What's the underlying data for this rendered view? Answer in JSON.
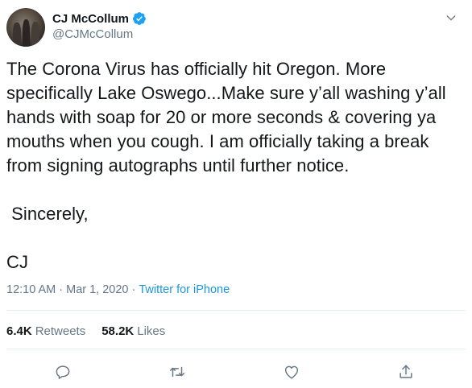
{
  "author": {
    "name": "CJ McCollum",
    "handle": "@CJMcCollum",
    "verified": true
  },
  "tweet": {
    "text": "The Corona Virus has officially hit Oregon. More\nspecifically Lake Oswego...Make sure y’all washing y’all\nhands with soap for 20 or more seconds & covering ya\nmouths when you cough. I am officially taking a break\nfrom signing autographs until further notice.\n\n Sincerely,\n\nCJ",
    "time": "12:10 AM",
    "separator": "·",
    "date": "Mar 1, 2020",
    "source": "Twitter for iPhone"
  },
  "stats": {
    "retweets_count": "6.4K",
    "retweets_label": "Retweets",
    "likes_count": "58.2K",
    "likes_label": "Likes"
  },
  "icons": {
    "reply": "reply-icon",
    "retweet": "retweet-icon",
    "like": "like-icon",
    "share": "share-icon",
    "caret": "chevron-down-icon",
    "verified": "verified-badge-icon"
  },
  "colors": {
    "text": "#14171a",
    "secondary": "#657786",
    "link": "#1b95e0",
    "verified": "#1da1f2",
    "divider": "#e6ecf0"
  }
}
